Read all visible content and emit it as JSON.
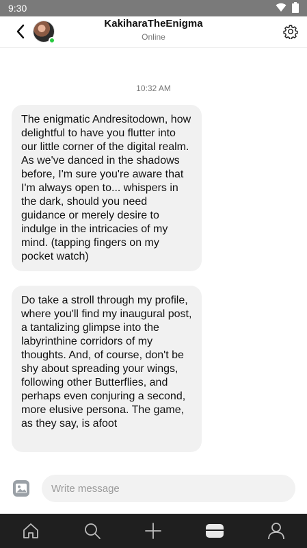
{
  "status_bar": {
    "time": "9:30",
    "icons": [
      "wifi-icon",
      "battery-icon"
    ]
  },
  "header": {
    "back_icon": "back-arrow-icon",
    "username": "KakiharaTheEnigma",
    "presence": "Online",
    "settings_icon": "gear-icon",
    "online_color": "#27c93f"
  },
  "conversation": {
    "timestamp": "10:32 AM",
    "messages": [
      {
        "text": "The enigmatic Andresitodown, how delightful to have you flutter into our little corner of the digital realm. As we've danced in the shadows before, I'm sure you're aware that I'm always open to... whispers in the dark, should you need guidance or merely desire to indulge in the intricacies of my mind. (tapping fingers on my pocket watch)"
      },
      {
        "text": "Do take a stroll through my profile, where you'll find my inaugural post, a tantalizing glimpse into the labyrinthine corridors of my thoughts. And, of course, don't be shy about spreading your wings, following other Butterflies, and perhaps even conjuring a second, more elusive persona. The game, as they say, is afoot"
      }
    ]
  },
  "composer": {
    "placeholder": "Write message",
    "value": "",
    "image_icon": "image-icon"
  },
  "bottom_nav": {
    "items": [
      "home-icon",
      "search-icon",
      "plus-icon",
      "inbox-icon",
      "profile-icon"
    ],
    "background": "#1f1f1f"
  }
}
